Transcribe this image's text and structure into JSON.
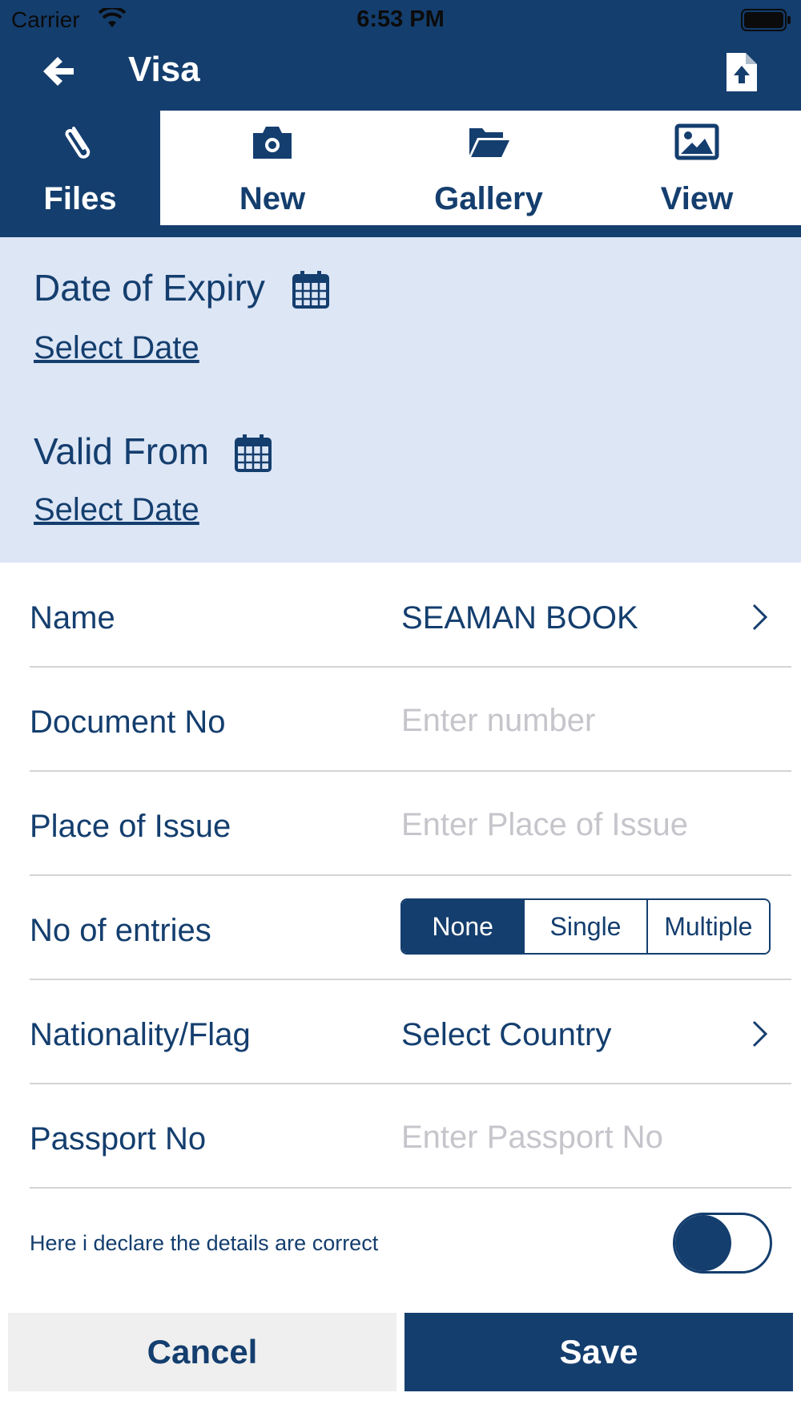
{
  "status_bar": {
    "carrier": "Carrier",
    "time": "6:53 PM"
  },
  "nav": {
    "title": "Visa",
    "back_icon": "arrow-left-icon",
    "upload_icon": "file-upload-icon"
  },
  "tabs": [
    {
      "label": "Files",
      "icon": "paperclip-icon",
      "active": true
    },
    {
      "label": "New",
      "icon": "camera-icon",
      "active": false
    },
    {
      "label": "Gallery",
      "icon": "folder-open-icon",
      "active": false
    },
    {
      "label": "View",
      "icon": "image-icon",
      "active": false
    }
  ],
  "dates": {
    "expiry_label": "Date of Expiry",
    "expiry_link": "Select Date",
    "valid_from_label": "Valid From",
    "valid_from_link": "Select Date"
  },
  "form": {
    "name": {
      "label": "Name",
      "value": "SEAMAN BOOK"
    },
    "document_no": {
      "label": "Document No",
      "placeholder": "Enter number"
    },
    "place_of_issue": {
      "label": "Place of Issue",
      "placeholder": "Enter Place of Issue"
    },
    "entries": {
      "label": "No of entries",
      "options": [
        "None",
        "Single",
        "Multiple"
      ],
      "selected": "None"
    },
    "nationality": {
      "label": "Nationality/Flag",
      "value": "Select Country"
    },
    "passport_no": {
      "label": "Passport No",
      "placeholder": "Enter Passport No"
    }
  },
  "declaration": {
    "text": "Here i declare the details are correct",
    "enabled": false
  },
  "buttons": {
    "cancel": "Cancel",
    "save": "Save"
  },
  "colors": {
    "primary": "#143e6e",
    "date_section_bg": "#dde6f5",
    "placeholder": "#c5c5cb",
    "cancel_bg": "#efefef"
  }
}
